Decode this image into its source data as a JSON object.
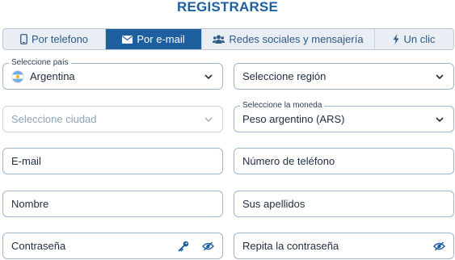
{
  "title": "REGISTRARSE",
  "tabs": [
    {
      "label": "Por telefono",
      "icon": "phone-icon",
      "active": false
    },
    {
      "label": "Por e-mail",
      "icon": "envelope-icon",
      "active": true
    },
    {
      "label": "Redes sociales y mensajería",
      "icon": "users-icon",
      "active": false
    },
    {
      "label": "Un clic",
      "icon": "lightning-icon",
      "active": false
    }
  ],
  "form": {
    "country": {
      "legend": "Seleccione país",
      "value": "Argentina",
      "flag": "argentina-flag"
    },
    "region": {
      "placeholder": "Seleccione región"
    },
    "city": {
      "placeholder": "Seleccione ciudad"
    },
    "currency": {
      "legend": "Seleccione la moneda",
      "value": "Peso argentino (ARS)"
    },
    "email": {
      "placeholder": "E-mail"
    },
    "phone": {
      "placeholder": "Número de teléfono"
    },
    "first_name": {
      "placeholder": "Nombre"
    },
    "last_name": {
      "placeholder": "Sus apellidos"
    },
    "password": {
      "placeholder": "Contraseña"
    },
    "password_repeat": {
      "placeholder": "Repita la contraseña"
    }
  },
  "colors": {
    "accent": "#1e5fa0",
    "border": "#9fb7cd",
    "tab_bg": "#e8eef4"
  }
}
